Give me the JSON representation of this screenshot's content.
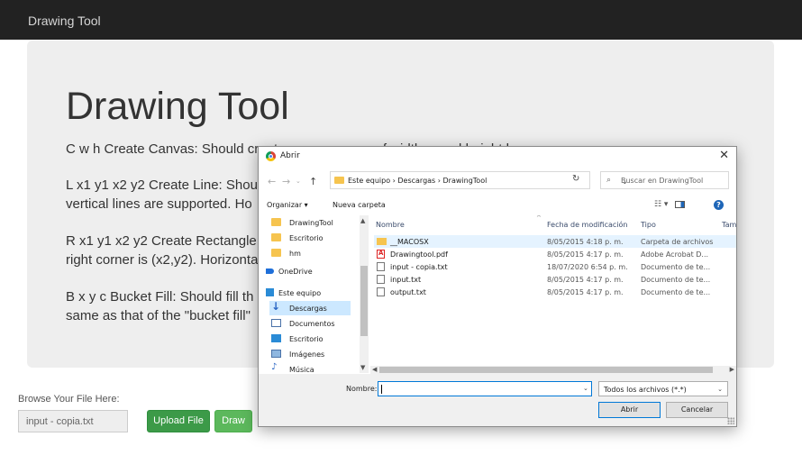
{
  "navbar": {
    "brand": "Drawing Tool"
  },
  "jumbotron": {
    "title": "Drawing Tool",
    "lines": [
      "C w h Create Canvas: Should create a new canvas of width w and height h.",
      "L x1 y1 x2 y2 Create Line: Shou",
      "vertical lines are supported. Ho",
      "R x1 y1 x2 y2 Create Rectangle",
      "right corner is (x2,y2). Horizonta",
      "B x y c Bucket Fill: Should fill th",
      "same as that of the \"bucket fill\""
    ]
  },
  "upload": {
    "label": "Browse Your File Here:",
    "file_value": "input - copia.txt",
    "upload_button": "Upload File",
    "draw_button": "Draw"
  },
  "dialog": {
    "title": "Abrir",
    "path": "Este equipo  ›  Descargas  ›  DrawingTool",
    "search_placeholder": "Buscar en DrawingTool",
    "toolbar": {
      "organize": "Organizar ▾",
      "new_folder": "Nueva carpeta"
    },
    "nav_items": [
      {
        "label": "DrawingTool",
        "icon": "folder-icon"
      },
      {
        "label": "Escritorio",
        "icon": "folder-icon"
      },
      {
        "label": "hm",
        "icon": "folder-icon"
      },
      {
        "label": "OneDrive",
        "icon": "cloud-icon"
      },
      {
        "label": "Este equipo",
        "icon": "computer-icon"
      },
      {
        "label": "Descargas",
        "icon": "download-icon"
      },
      {
        "label": "Documentos",
        "icon": "document-icon"
      },
      {
        "label": "Escritorio",
        "icon": "desktop-icon"
      },
      {
        "label": "Imágenes",
        "icon": "images-icon"
      },
      {
        "label": "Música",
        "icon": "music-icon"
      }
    ],
    "columns": {
      "name": "Nombre",
      "date": "Fecha de modificación",
      "type": "Tipo",
      "size": "Tama"
    },
    "files": [
      {
        "name": "__MACOSX",
        "date": "8/05/2015 4:18 p. m.",
        "type": "Carpeta de archivos",
        "icon": "folder-icon"
      },
      {
        "name": "Drawingtool.pdf",
        "date": "8/05/2015 4:17 p. m.",
        "type": "Adobe Acrobat D...",
        "icon": "pdf-icon"
      },
      {
        "name": "input - copia.txt",
        "date": "18/07/2020 6:54 p. m.",
        "type": "Documento de te...",
        "icon": "text-file-icon"
      },
      {
        "name": "input.txt",
        "date": "8/05/2015 4:17 p. m.",
        "type": "Documento de te...",
        "icon": "text-file-icon"
      },
      {
        "name": "output.txt",
        "date": "8/05/2015 4:17 p. m.",
        "type": "Documento de te...",
        "icon": "text-file-icon"
      }
    ],
    "filename_label": "Nombre:",
    "filename_value": "",
    "filetype": "Todos los archivos (*.*)",
    "open_button": "Abrir",
    "cancel_button": "Cancelar"
  }
}
